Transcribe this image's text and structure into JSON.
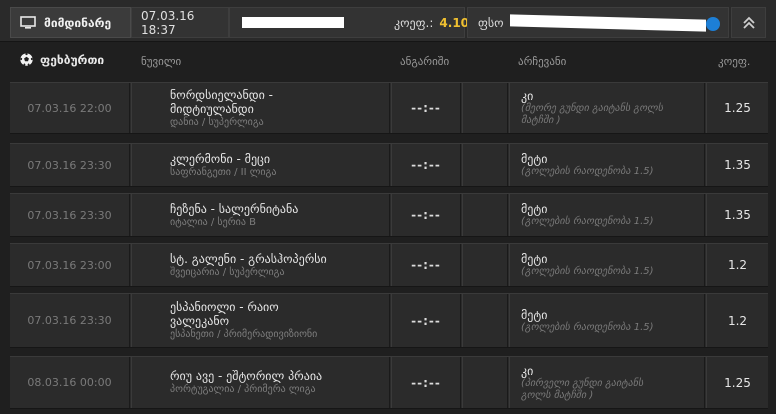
{
  "topbar": {
    "current_tab": "მიმდინარე",
    "datetime": "07.03.16 18:37",
    "odds_label": "კოეფ.:",
    "odds_value": "4.10",
    "right_label": "ფსო"
  },
  "header": {
    "sport": "ფეხბურთი",
    "col_event": "ნუვილი",
    "col_score": "ანგარიში",
    "col_choice": "არჩევანი",
    "col_odds": "კოეფ."
  },
  "rows": [
    {
      "date": "07.03.16 22:00",
      "teams": "ნორდსიელანდი -\nმიდტიულანდი",
      "league": "დანია / სუპერლიგა",
      "score": "--:--",
      "pick": "კი",
      "pick_detail": "(მეორე გუნდი გაიტანს გოლს\nმატჩში )",
      "odds": "1.25"
    },
    {
      "date": "07.03.16 23:30",
      "teams": "კლერმონი - მეცი",
      "league": "საფრანგეთი / II ლიგა",
      "score": "--:--",
      "pick": "მეტი",
      "pick_detail": "(გოლების რაოდენობა 1.5)",
      "odds": "1.35"
    },
    {
      "date": "07.03.16 23:30",
      "teams": "ჩეზენა - სალერნიტანა",
      "league": "იტალია / სერია B",
      "score": "--:--",
      "pick": "მეტი",
      "pick_detail": "(გოლების რაოდენობა 1.5)",
      "odds": "1.35"
    },
    {
      "date": "07.03.16 23:00",
      "teams": "სტ. გალენი - გრასჰოპერსი",
      "league": "შვეიცარია / სუპერლიგა",
      "score": "--:--",
      "pick": "მეტი",
      "pick_detail": "(გოლების რაოდენობა 1.5)",
      "odds": "1.2"
    },
    {
      "date": "07.03.16 23:30",
      "teams": "ესპანიოლი - რაიო\nვალეკანო",
      "league": "ესპანეთი / პრიმერადივიზიონი",
      "score": "--:--",
      "pick": "მეტი",
      "pick_detail": "(გოლების რაოდენობა 1.5)",
      "odds": "1.2"
    },
    {
      "date": "08.03.16 00:00",
      "teams": "რიუ ავე - ეშტორილ პრაია",
      "league": "პორტუგალია / პრიმერა ლიგა",
      "score": "--:--",
      "pick": "კი",
      "pick_detail": "(პირველი გუნდი გაიტანს\nგოლს მატჩში )",
      "odds": "1.25"
    }
  ]
}
